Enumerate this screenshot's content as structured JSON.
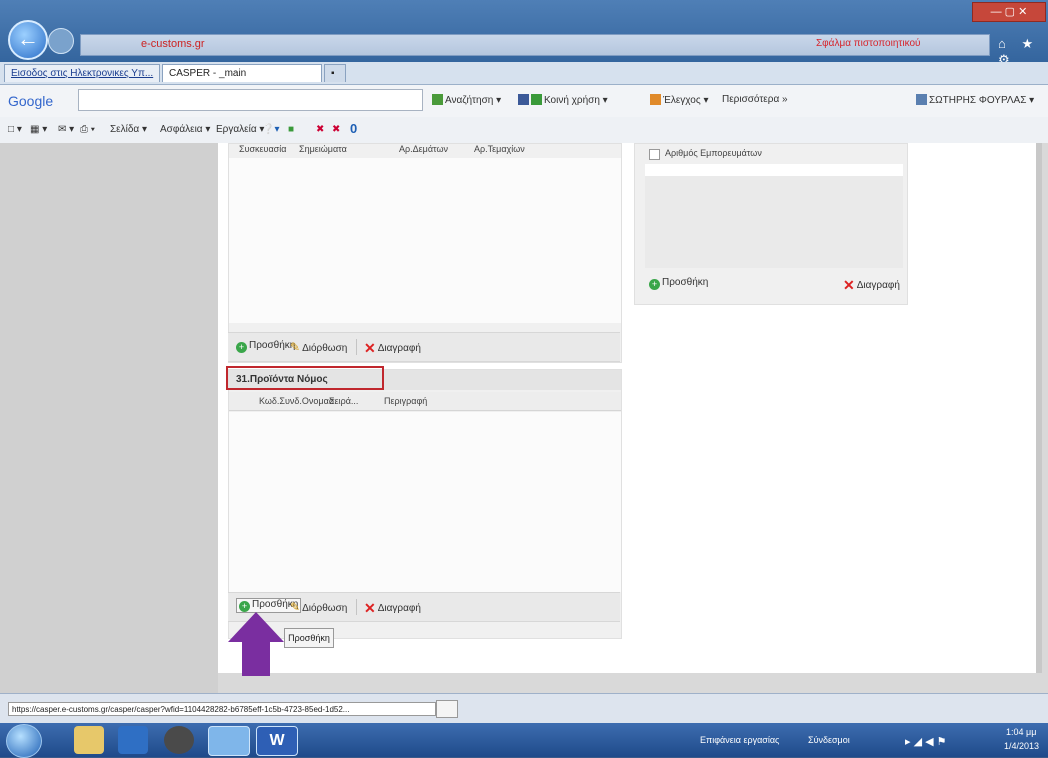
{
  "browser": {
    "address_text": "e-customs.gr",
    "search_hint": "Σφάλμα πιστοποιητικού",
    "window_controls": "— ▢ ✕",
    "toolbar_icons": "⌂ ★ ⚙",
    "tabs": [
      {
        "label": "Εισοδος στις Ηλεκτρονικες Υπ..."
      },
      {
        "label": "CASPER - _main"
      }
    ],
    "new_tab": "▪"
  },
  "google_toolbar": {
    "logo": "Google",
    "items": [
      "Αναζήτηση ▾",
      "Κοινή χρήση ▾",
      "Έλεγχος ▾",
      "Περισσότερα »",
      "ΣΩΤΗΡΗΣ ΦΟΥΡΛΑΣ ▾"
    ]
  },
  "command_bar": {
    "items": [
      "Σελίδα ▾",
      "Ασφάλεια ▾",
      "Εργαλεία ▾"
    ]
  },
  "top_left_panel": {
    "columns": [
      "Συσκευασία",
      "Σημειώματα",
      "Αρ.Δεμάτων",
      "Αρ.Τεμαχίων"
    ],
    "toolbar": {
      "add": "Προσθήκη",
      "edit": "Διόρθωση",
      "delete": "Διαγραφή"
    }
  },
  "top_right_panel": {
    "checkbox_label": "Αριθμός Εμπορευμάτων",
    "toolbar": {
      "add": "Προσθήκη",
      "delete": "Διαγραφή"
    }
  },
  "section_31": {
    "title": "31.Προϊόντα Νόμος",
    "columns": [
      "Κωδ.Συνδ.Ονομασ.",
      "Σειρά...",
      "Περιγραφή"
    ],
    "toolbar": {
      "add": "Προσθήκη",
      "edit": "Διόρθωση",
      "delete": "Διαγραφή"
    },
    "extra_button": "Προσθήκη"
  },
  "status_bar": {
    "url": "https://casper.e-customs.gr/casper/casper?wfid=1104428282-b6785eff-1c5b-4723-85ed-1d52..."
  },
  "taskbar": {
    "tray_lang": "Επιφάνεια εργασίας",
    "tray_links": "Σύνδεσμοι",
    "time": "1:04 μμ",
    "date": "1/4/2013"
  },
  "colors": {
    "highlight_border": "#c0272d",
    "arrow": "#7a2ea0"
  }
}
